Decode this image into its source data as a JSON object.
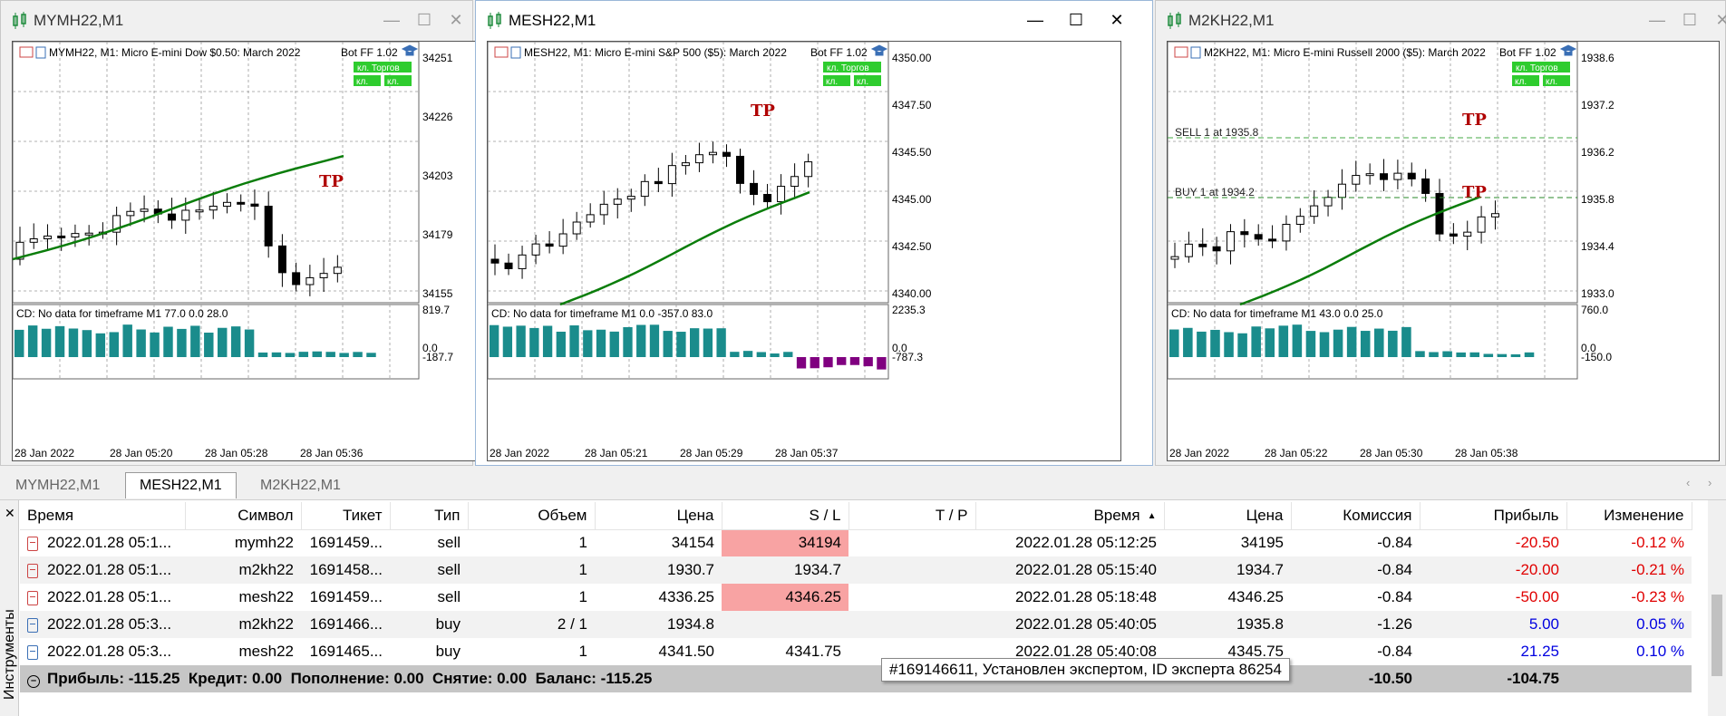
{
  "windows": [
    {
      "title": "MYMH22,M1",
      "header": "MYMH22, M1:  Micro E-mini Dow $0.50: March 2022",
      "bot": "Bot FF 1.02",
      "buttons": [
        "кл. Торгов",
        "кл.",
        "кл."
      ],
      "price_labels": [
        "34251",
        "34226",
        "34203",
        "34179",
        "34155"
      ],
      "indicator_label": "CD: No data for timeframe M1 77.0 0.0 28.0",
      "indicator_scale": [
        "819.7",
        "0.0",
        "-187.7"
      ],
      "time_labels": [
        "28 Jan 2022",
        "28 Jan 05:20",
        "28 Jan 05:28",
        "28 Jan 05:36"
      ],
      "annotations": [
        "TP"
      ]
    },
    {
      "title": "MESH22,M1",
      "header": "MESH22, M1:  Micro E-mini S&P 500 ($5): March 2022",
      "bot": "Bot FF 1.02",
      "buttons": [
        "кл. Торгов",
        "кл.",
        "кл."
      ],
      "price_labels": [
        "4350.00",
        "4347.50",
        "4345.50",
        "4345.00",
        "4342.50",
        "4340.00"
      ],
      "indicator_label": "CD: No data for timeframe M1 0.0 -357.0 83.0",
      "indicator_scale": [
        "2235.3",
        "0.0",
        "-787.3"
      ],
      "time_labels": [
        "28 Jan 2022",
        "28 Jan 05:21",
        "28 Jan 05:29",
        "28 Jan 05:37"
      ],
      "annotations": [
        "TP"
      ]
    },
    {
      "title": "M2KH22,M1",
      "header": "M2KH22, M1:  Micro E-mini Russell 2000 ($5): March 2022",
      "bot": "Bot FF 1.02",
      "buttons": [
        "кл. Торгов",
        "кл.",
        "кл."
      ],
      "price_labels": [
        "1938.6",
        "1937.2",
        "1936.2",
        "1935.8",
        "1934.4",
        "1933.0"
      ],
      "indicator_label": "CD: No data for timeframe M1 43.0 0.0 25.0",
      "indicator_scale": [
        "760.0",
        "0.0",
        "-150.0"
      ],
      "time_labels": [
        "28 Jan 2022",
        "28 Jan 05:22",
        "28 Jan 05:30",
        "28 Jan 05:38"
      ],
      "annotations": [
        "TP",
        "TP"
      ],
      "lines": [
        "SELL 1 at 1935.8",
        "BUY 1 at 1934.2"
      ]
    }
  ],
  "chart_tabs": [
    "MYMH22,M1",
    "MESH22,M1",
    "M2KH22,M1"
  ],
  "table": {
    "headers": [
      "Время",
      "Символ",
      "Тикет",
      "Тип",
      "Объем",
      "Цена",
      "S / L",
      "T / P",
      "Время",
      "Цена",
      "Комиссия",
      "Прибыль",
      "Изменение"
    ],
    "rows": [
      {
        "time": "2022.01.28 05:1...",
        "symbol": "mymh22",
        "ticket": "1691459...",
        "type": "sell",
        "volume": "1",
        "price": "34154",
        "sl": "34194",
        "tp": "",
        "time2": "2022.01.28 05:12:25",
        "price2": "34195",
        "commission": "-0.84",
        "profit": "-20.50",
        "change": "-0.12 %"
      },
      {
        "time": "2022.01.28 05:1...",
        "symbol": "m2kh22",
        "ticket": "1691458...",
        "type": "sell",
        "volume": "1",
        "price": "1930.7",
        "sl": "1934.7",
        "tp": "",
        "time2": "2022.01.28 05:15:40",
        "price2": "1934.7",
        "commission": "-0.84",
        "profit": "-20.00",
        "change": "-0.21 %"
      },
      {
        "time": "2022.01.28 05:1...",
        "symbol": "mesh22",
        "ticket": "1691459...",
        "type": "sell",
        "volume": "1",
        "price": "4336.25",
        "sl": "4346.25",
        "tp": "",
        "time2": "2022.01.28 05:18:48",
        "price2": "4346.25",
        "commission": "-0.84",
        "profit": "-50.00",
        "change": "-0.23 %"
      },
      {
        "time": "2022.01.28 05:3...",
        "symbol": "m2kh22",
        "ticket": "1691466...",
        "type": "buy",
        "volume": "2 / 1",
        "price": "1934.8",
        "sl": "",
        "tp": "",
        "time2": "2022.01.28 05:40:05",
        "price2": "1935.8",
        "commission": "-1.26",
        "profit": "5.00",
        "change": "0.05 %"
      },
      {
        "time": "2022.01.28 05:3...",
        "symbol": "mesh22",
        "ticket": "1691465...",
        "type": "buy",
        "volume": "1",
        "price": "4341.50",
        "sl": "4341.75",
        "tp": "",
        "time2": "2022.01.28 05:40:08",
        "price2": "4345.75",
        "commission": "-0.84",
        "profit": "21.25",
        "change": "0.10 %"
      }
    ],
    "totals": {
      "summary": "Прибыль: -115.25  Кредит: 0.00  Пополнение: 0.00  Снятие: 0.00  Баланс: -115.25",
      "commission": "-10.50",
      "profit": "-104.75"
    }
  },
  "tooltip": "#169146611, Установлен экспертом, ID эксперта 86254",
  "sidebar_label": "Инструменты",
  "colors": {
    "bull": "#ffffff",
    "bear": "#000000",
    "ma": "#0a7d0a",
    "hist": "#1a8c8c",
    "hist_neg": "#800080",
    "loss_bg": "#f8a3a3",
    "neg": "#e00000",
    "pos": "#0000e0"
  }
}
